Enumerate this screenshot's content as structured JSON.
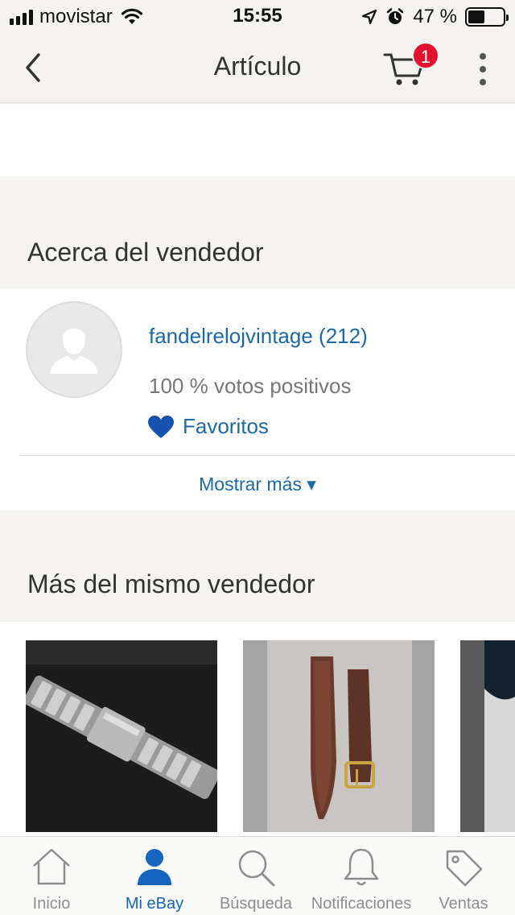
{
  "status_bar": {
    "carrier": "movistar",
    "time": "15:55",
    "battery_percent": "47 %",
    "battery_level": 0.47,
    "icons": [
      "signal-icon",
      "wifi-icon",
      "location-arrow-icon",
      "alarm-icon",
      "battery-icon"
    ]
  },
  "nav": {
    "title": "Artículo",
    "cart_count": "1",
    "icons": [
      "back-chevron-icon",
      "cart-icon",
      "more-vertical-icon"
    ]
  },
  "seller_section": {
    "heading": "Acerca del vendedor",
    "seller_name": "fandelrelojvintage (212)",
    "feedback": "100 % votos positivos",
    "favorites_label": "Favoritos",
    "show_more_label": "Mostrar más ▾"
  },
  "more_section": {
    "heading": "Más del mismo vendedor",
    "items": [
      {
        "image": "metal-watch-bracelet"
      },
      {
        "image": "brown-leather-watch-strap"
      },
      {
        "image": "partial-item"
      }
    ]
  },
  "tab_bar": {
    "tabs": [
      {
        "label": "Inicio",
        "icon": "home-icon"
      },
      {
        "label": "Mi eBay",
        "icon": "user-icon",
        "active": true
      },
      {
        "label": "Búsqueda",
        "icon": "search-icon"
      },
      {
        "label": "Notificaciones",
        "icon": "bell-icon"
      },
      {
        "label": "Ventas",
        "icon": "tag-icon"
      }
    ]
  },
  "colors": {
    "accent_blue": "#1b6aa6",
    "active_tab_blue": "#1565c0",
    "badge_red": "#e0122f",
    "background": "#f4f3f0"
  }
}
